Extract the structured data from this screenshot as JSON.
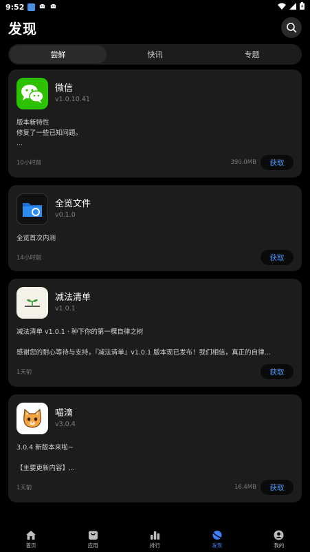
{
  "status": {
    "time": "9:52",
    "colors": {
      "app1": "#4a90e2",
      "app2": "#ffffff"
    },
    "icons": [
      "wifi-icon",
      "signal-icon",
      "battery-icon"
    ]
  },
  "header": {
    "title": "发现",
    "search_icon": "search-icon"
  },
  "tabs": [
    {
      "label": "尝鲜",
      "active": true
    },
    {
      "label": "快讯",
      "active": false
    },
    {
      "label": "专题",
      "active": false
    }
  ],
  "apps": [
    {
      "name": "微信",
      "version": "v1.0.10.41",
      "icon": "wechat-icon",
      "icon_bg": "#2dc100",
      "desc": [
        "版本新特性",
        "修复了一些已知问题。",
        "..."
      ],
      "time": "10小时前",
      "size": "390.0MB",
      "button": "获取"
    },
    {
      "name": "全览文件",
      "version": "v0.1.0",
      "icon": "folder-icon",
      "icon_bg": "#111111",
      "desc": [
        "全览首次内测"
      ],
      "time": "14小时前",
      "size": "",
      "button": "获取"
    },
    {
      "name": "减法清单",
      "version": "v1.0.1",
      "icon": "sprout-icon",
      "icon_bg": "#f4f1e6",
      "desc": [
        "减法清单 v1.0.1 · 种下你的第一棵自律之树",
        "",
        "感谢您的耐心等待与支持，『减法清单』v1.0.1 版本现已发布！我们相信，真正的自律..."
      ],
      "time": "1天前",
      "size": "",
      "button": "获取"
    },
    {
      "name": "喵滴",
      "version": "v3.0.4",
      "icon": "cat-icon",
      "icon_bg": "#ffffff",
      "desc": [
        "3.0.4 新版本来啦~",
        "",
        "【主要更新内容】..."
      ],
      "time": "1天前",
      "size": "16.4MB",
      "button": "获取"
    }
  ],
  "nav": [
    {
      "label": "首页",
      "icon": "home-icon",
      "active": false
    },
    {
      "label": "应用",
      "icon": "apps-icon",
      "active": false
    },
    {
      "label": "排行",
      "icon": "ranking-icon",
      "active": false
    },
    {
      "label": "发现",
      "icon": "discover-icon",
      "active": true
    },
    {
      "label": "我的",
      "icon": "profile-icon",
      "active": false
    }
  ],
  "accent_color": "#3f7fff"
}
